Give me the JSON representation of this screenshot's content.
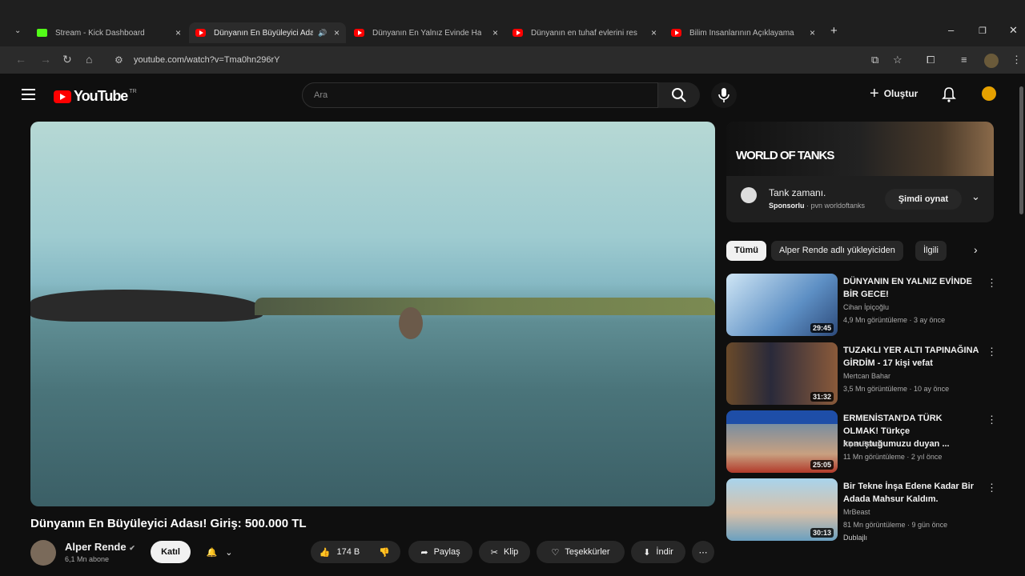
{
  "browser": {
    "tabs": [
      {
        "label": "Stream - Kick Dashboard",
        "icon": "kick-icon"
      },
      {
        "label": "Dünyanın En Büyüleyici Ada",
        "icon": "youtube-icon",
        "active": true
      },
      {
        "label": "Dünyanın En Yalnız Evinde Hay",
        "icon": "youtube-icon"
      },
      {
        "label": "Dünyanın en tuhaf evlerini res",
        "icon": "youtube-icon"
      },
      {
        "label": "Bilim İnsanlarının Açıklayama",
        "icon": "youtube-icon"
      }
    ],
    "new_tab": "+",
    "url": "youtube.com/watch?v=Tma0hn296rY"
  },
  "youtube": {
    "logo_text": "YouTube",
    "country": "TR",
    "search_placeholder": "Ara",
    "create_label": "Oluştur"
  },
  "video": {
    "title": "Dünyanın En Büyüleyici Adası! Giriş: 500.000 TL",
    "channel": "Alper Rende",
    "subscribers": "6,1 Mn abone",
    "join_label": "Katıl",
    "likes": "174 B",
    "share_label": "Paylaş",
    "clip_label": "Klip",
    "thanks_label": "Teşekkürler",
    "download_label": "İndir"
  },
  "ad": {
    "logo": "WORLD OF TANKS",
    "title": "Tank zamanı.",
    "sponsor": "Sponsorlu",
    "sponsor_rest": "· pvn worldoftanks",
    "button": "Şimdi oynat"
  },
  "chips": [
    "Tümü",
    "Alper Rende adlı yükleyiciden",
    "İlgili"
  ],
  "recommendations": [
    {
      "title": "DÜNYANIN EN YALNIZ EVİNDE BİR GECE!",
      "channel": "Cihan İpiçoğlu",
      "meta": "4,9 Mn görüntüleme · 3 ay önce",
      "duration": "29:45"
    },
    {
      "title": "TUZAKLI YER ALTI TAPINAĞINA GİRDİM - 17 kişi vefat",
      "channel": "Mertcan Bahar",
      "meta": "3,5 Mn görüntüleme · 10 ay önce",
      "duration": "31:32"
    },
    {
      "title": "ERMENİSTAN'DA TÜRK OLMAK! Türkçe konuştuğumuzu duyan ...",
      "channel": "Alper Rende",
      "meta": "11 Mn görüntüleme · 2 yıl önce",
      "duration": "25:05"
    },
    {
      "title": "Bir Tekne İnşa Edene Kadar Bir Adada Mahsur Kaldım.",
      "channel": "MrBeast",
      "meta": "81 Mn görüntüleme · 9 gün önce",
      "duration": "30:13",
      "badge": "Dublajlı"
    }
  ]
}
